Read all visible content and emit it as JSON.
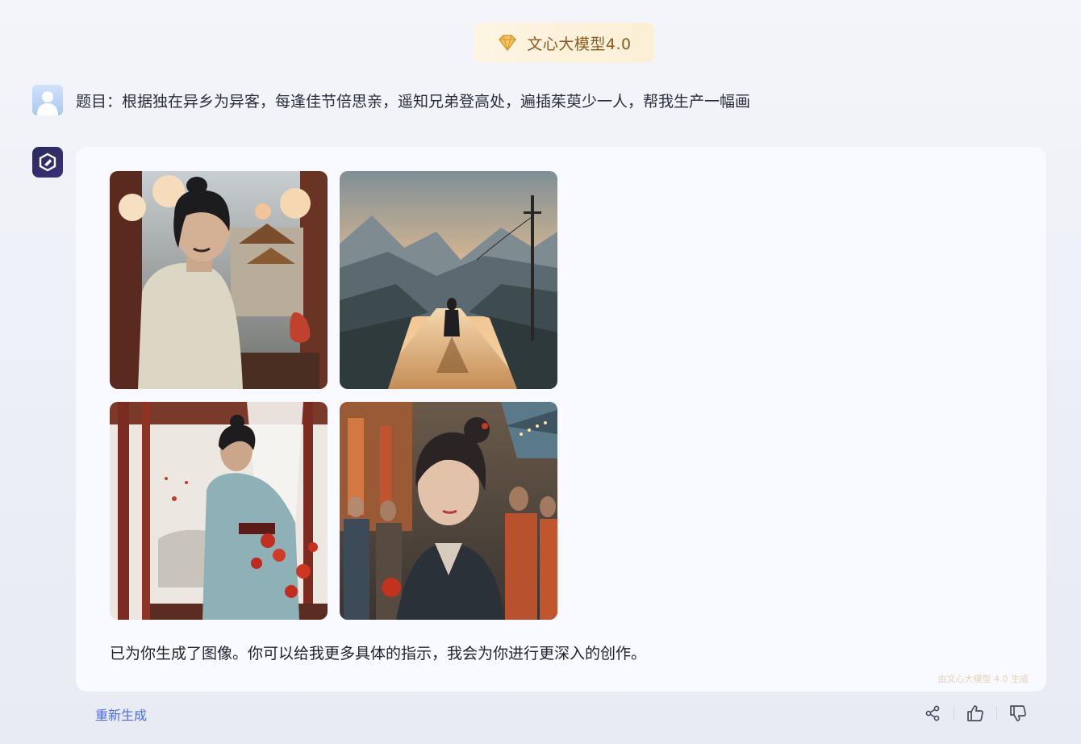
{
  "header": {
    "model_label": "文心大模型4.0",
    "gem_icon": "diamond-icon"
  },
  "user_message": {
    "text": "题目：根据独在异乡为异客，每逢佳节倍思亲，遥知兄弟登高处，遍插茱萸少一人，帮我生产一幅画"
  },
  "assistant_message": {
    "images": [
      {
        "name": "image-man-lanterns"
      },
      {
        "name": "image-road-landscape"
      },
      {
        "name": "image-man-blue-robe"
      },
      {
        "name": "image-woman-crowd"
      }
    ],
    "text": "已为你生成了图像。你可以给我更多具体的指示，我会为你进行更深入的创作。",
    "watermark": "由文心大模型 4.0 生成"
  },
  "footer": {
    "regenerate_label": "重新生成",
    "icons": [
      "share-icon",
      "thumbs-up-icon",
      "thumbs-down-icon"
    ]
  },
  "colors": {
    "accent": "#4b6ee6",
    "badge_bg": "#fbf0d6",
    "badge_text": "#8a5a1e"
  }
}
